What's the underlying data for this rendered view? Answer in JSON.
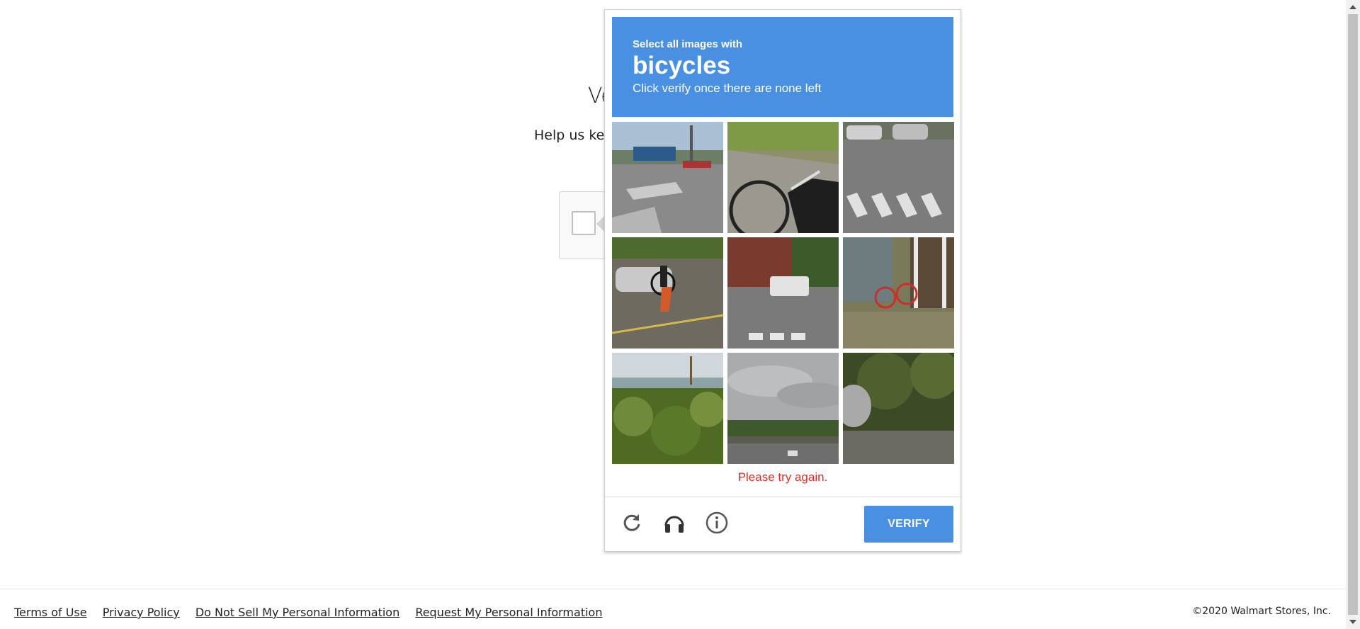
{
  "page": {
    "heading_fragment": "Ve",
    "help_text_fragment": "Help us kee"
  },
  "challenge": {
    "header": {
      "instruction": "Select all images with",
      "target": "bicycles",
      "subtext": "Click verify once there are none left"
    },
    "tiles": [
      {
        "label": "tile-1",
        "scene": "intersection with crosswalk and storefront"
      },
      {
        "label": "tile-2",
        "scene": "bicycle wheel on sidewalk"
      },
      {
        "label": "tile-3",
        "scene": "crosswalk with parked cars"
      },
      {
        "label": "tile-4",
        "scene": "road with car and cyclist"
      },
      {
        "label": "tile-5",
        "scene": "street with white truck"
      },
      {
        "label": "tile-6",
        "scene": "red bicycle by porch"
      },
      {
        "label": "tile-7",
        "scene": "green shrubs and palm"
      },
      {
        "label": "tile-8",
        "scene": "highway overpass under cloudy sky"
      },
      {
        "label": "tile-9",
        "scene": "trees and car edge"
      }
    ],
    "error": "Please try again.",
    "verify_label": "VERIFY",
    "controls": [
      "reload-icon",
      "audio-icon",
      "info-icon"
    ],
    "accent_color": "#4a90e2",
    "error_color": "#d93025"
  },
  "footer": {
    "links": [
      "Terms of Use",
      "Privacy Policy",
      "Do Not Sell My Personal Information",
      "Request My Personal Information"
    ],
    "copyright": "©2020 Walmart Stores, Inc."
  }
}
